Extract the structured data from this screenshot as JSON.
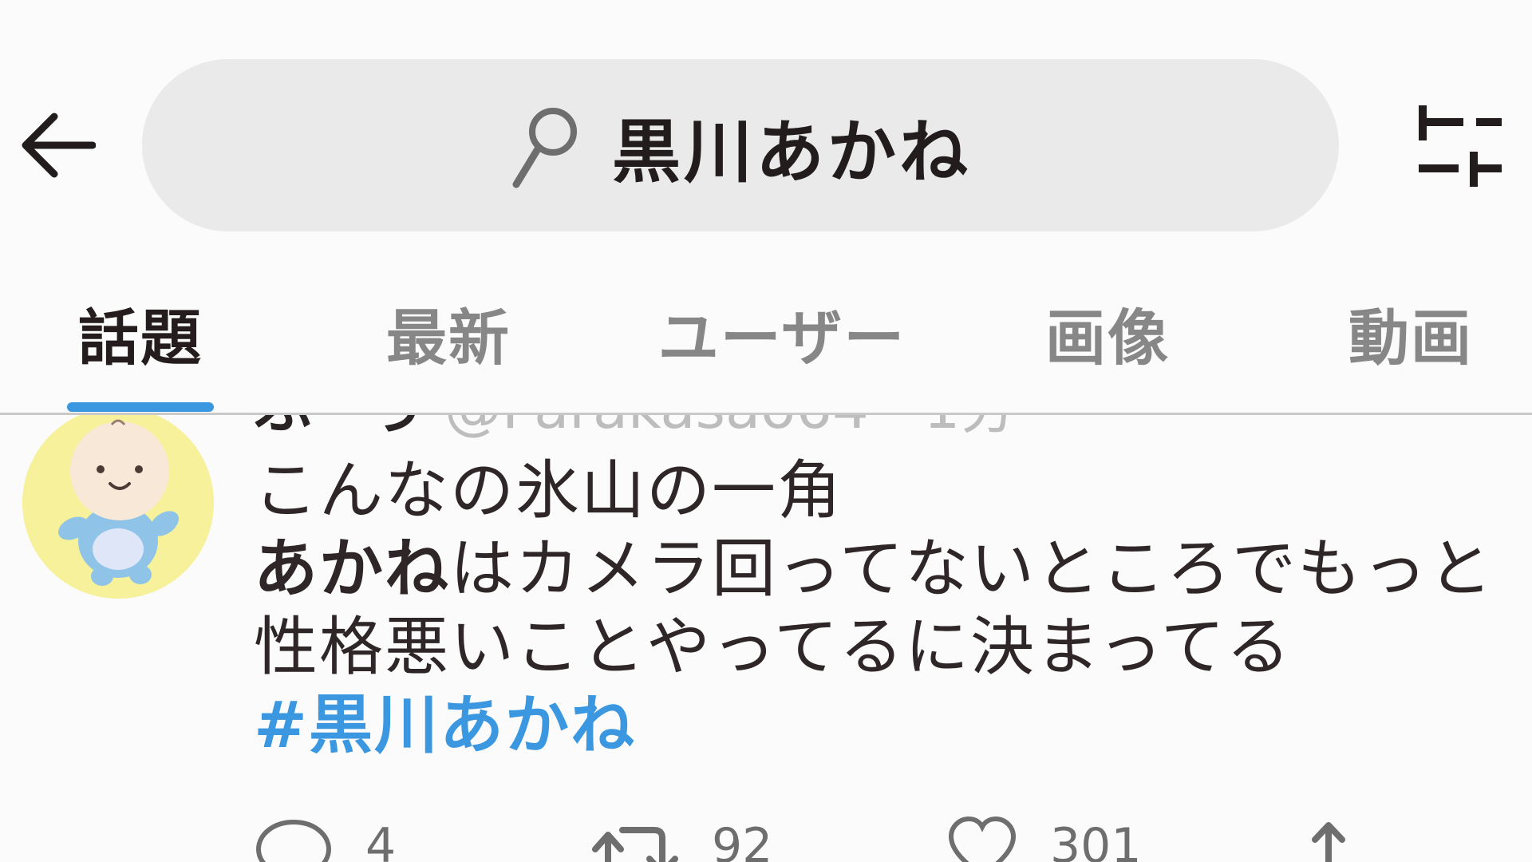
{
  "search": {
    "query": "黒川あかね"
  },
  "tabs": [
    {
      "label": "話題",
      "active": true
    },
    {
      "label": "最新",
      "active": false
    },
    {
      "label": "ユーザー",
      "active": false
    },
    {
      "label": "画像",
      "active": false
    },
    {
      "label": "動画",
      "active": false
    }
  ],
  "tweet": {
    "lines": [
      {
        "bold": "",
        "text": "こんなの氷山の一角"
      },
      {
        "bold": "あかね",
        "text": "はカメラ回ってないところでもっと"
      },
      {
        "bold": "",
        "text": "性格悪いことやってるに決まってる"
      }
    ],
    "hashtag": "#黒川あかね",
    "reply_count": "4",
    "retweet_count": "92",
    "like_count": "301"
  },
  "icons": {
    "back": "arrow-left-icon",
    "search": "search-icon",
    "filter": "filter-sliders-icon",
    "reply": "reply-bubble-icon",
    "retweet": "retweet-icon",
    "like": "heart-icon",
    "share": "share-icon"
  },
  "colors": {
    "accent": "#3b98e0",
    "search_bg": "#eaeaea",
    "avatar_bg": "#f6f19a"
  }
}
